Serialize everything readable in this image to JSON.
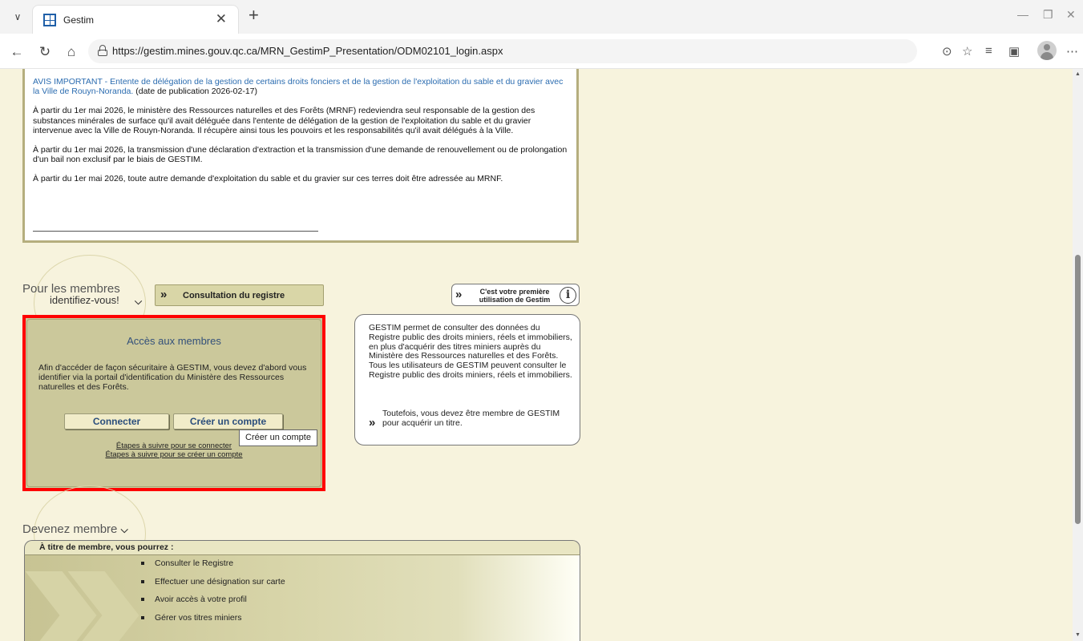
{
  "browser": {
    "tab_title": "Gestim",
    "url": "https://gestim.mines.gouv.qc.ca/MRN_GestimP_Presentation/ODM02101_login.aspx"
  },
  "notice": {
    "avis_link": "AVIS IMPORTANT - Entente de délégation de la gestion de certains droits fonciers et de la gestion de l'exploitation du sable et du gravier avec la Ville de Rouyn-Noranda.",
    "avis_date": "(date de publication 2026-02-17)",
    "para1": "À partir du 1er mai 2026, le ministère des Ressources naturelles et des Forêts (MRNF) redeviendra seul responsable de la gestion des substances minérales de surface qu'il avait déléguée dans l'entente de délégation de la gestion de l'exploitation du sable et du gravier intervenue avec la Ville de Rouyn-Noranda. Il récupère ainsi tous les pouvoirs et les responsabilités qu'il avait délégués à la Ville.",
    "para2": "À partir du 1er mai 2026, la transmission d'une déclaration d'extraction et la transmission d'une demande de renouvellement ou de prolongation d'un bail non exclusif par le biais de GESTIM.",
    "para3": "À partir du 1er mai 2026, toute autre demande d'exploitation du sable et du gravier sur ces terres doit être adressée au MRNF."
  },
  "members": {
    "pour_title": "Pour les membres",
    "pour_sub": "identifiez-vous!",
    "consult_label": "Consultation du registre",
    "first_use_label": "C'est votre première utilisation de Gestim",
    "acces_title": "Accès aux membres",
    "acces_text": "Afin d'accéder de façon sécuritaire à GESTIM, vous devez d'abord vous identifier via la portail d'identification du Ministère des Ressources naturelles et des Forêts.",
    "connect_label": "Connecter",
    "create_label": "Créer un compte",
    "steps_connect": "Étapes à suivre pour se connecter",
    "steps_create": "Étapes à suivre pour se créer un compte",
    "tooltip": "Créer un compte"
  },
  "info": {
    "description": "GESTIM permet de consulter des données du Registre public des droits miniers, réels et immobiliers, en plus d'acquérir des titres miniers auprès du Ministère des Ressources naturelles et des Forêts. Tous les utilisateurs de GESTIM peuvent consulter le Registre public des droits miniers, réels et immobiliers.",
    "note": "Toutefois, vous devez être membre de GESTIM pour acquérir un titre."
  },
  "devenez": {
    "title": "Devenez membre",
    "bar_label": "À titre de membre, vous pourrez :",
    "benefits": [
      "Consulter le Registre",
      "Effectuer une désignation sur carte",
      "Avoir accès à votre profil",
      "Gérer vos titres miniers"
    ]
  },
  "colors": {
    "highlight_border": "#ff0000",
    "panel": "#cbc89b",
    "page_background": "#f7f3dd",
    "link": "#2b6cb0"
  }
}
